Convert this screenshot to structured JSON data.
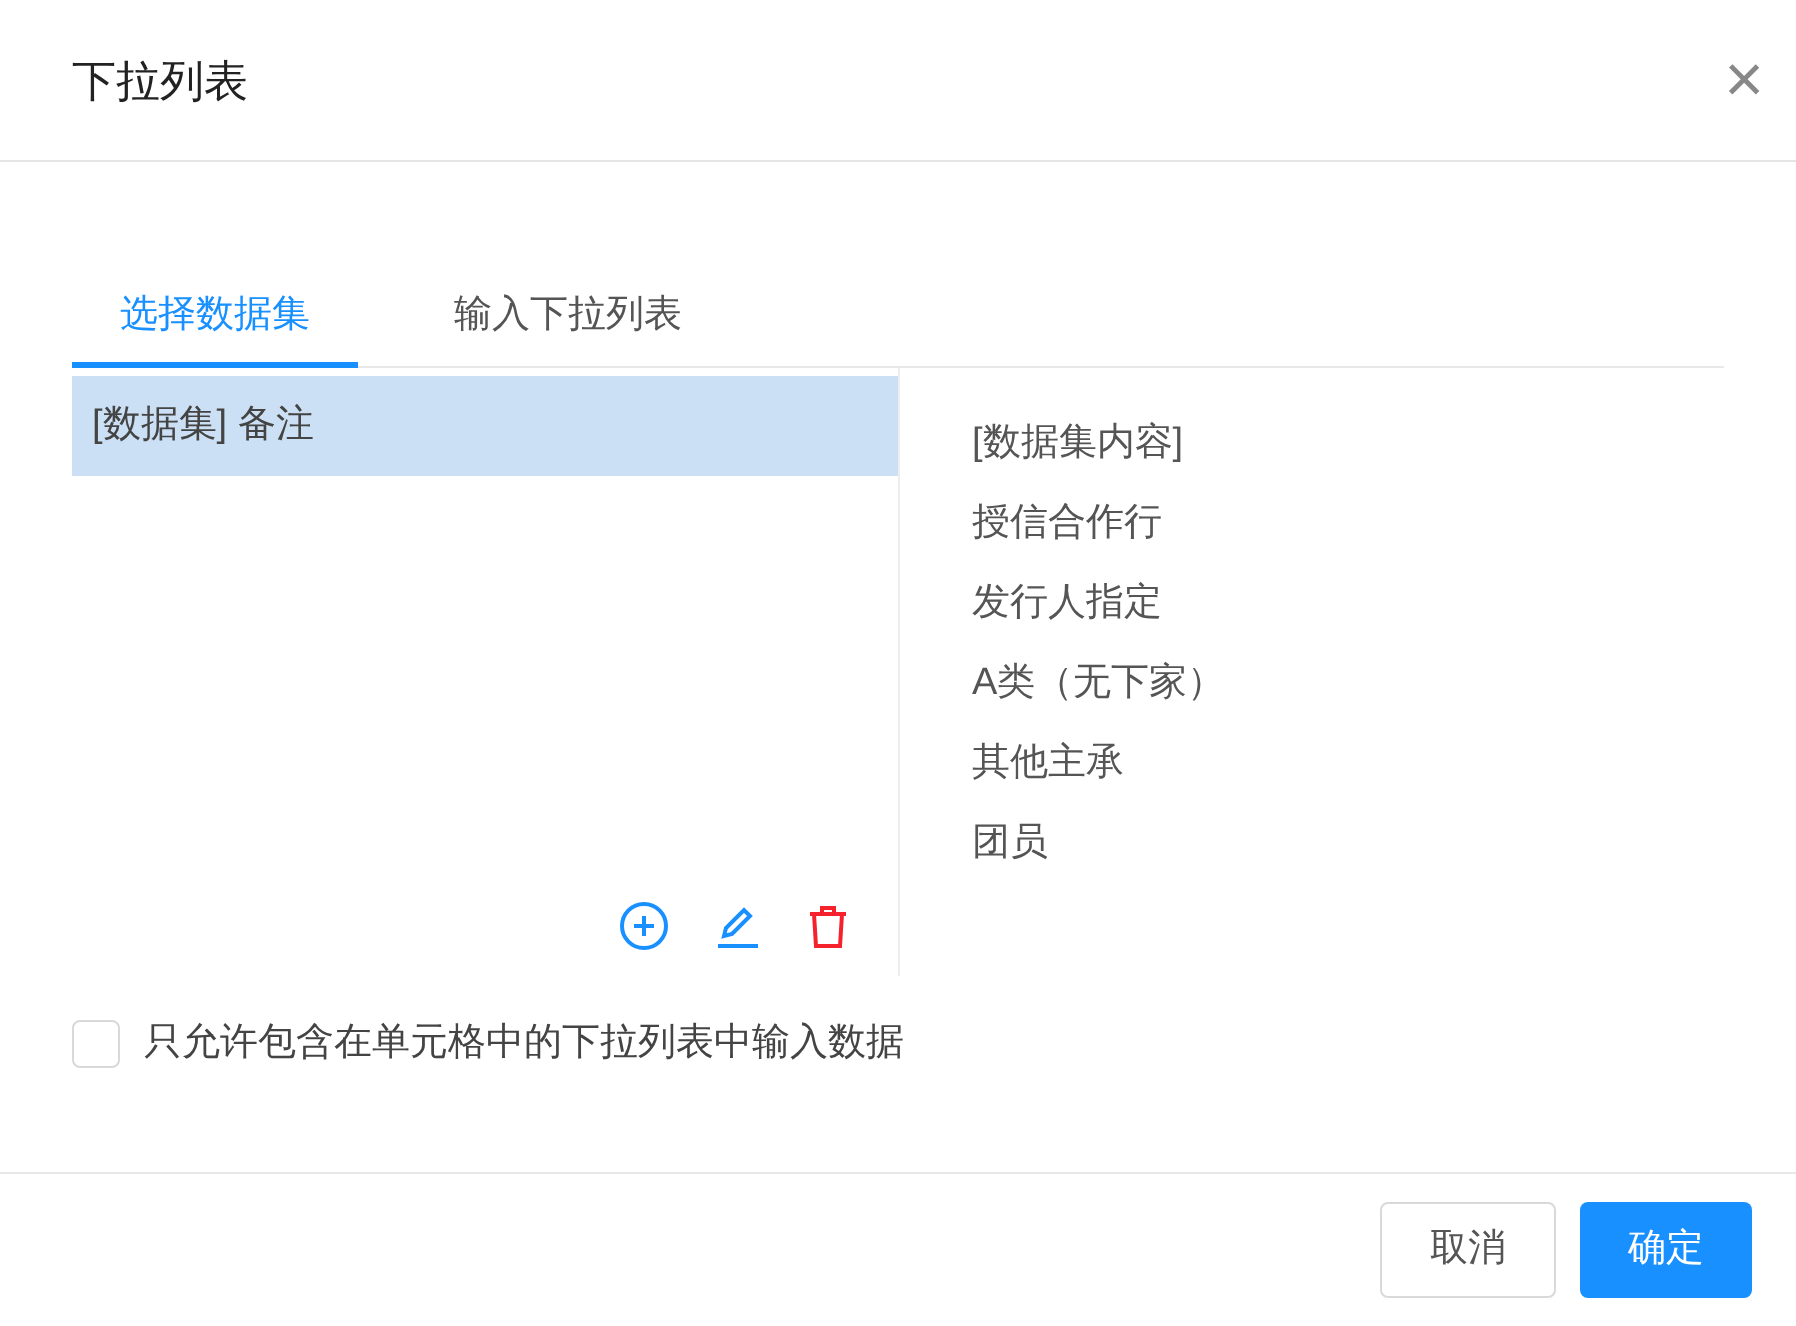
{
  "dialog": {
    "title": "下拉列表",
    "close": "×"
  },
  "tabs": [
    {
      "label": "选择数据集",
      "selected": true
    },
    {
      "label": "输入下拉列表",
      "selected": false
    }
  ],
  "datasets": [
    {
      "label": "[数据集] 备注",
      "selected": true
    }
  ],
  "content": {
    "heading": "[数据集内容]",
    "items": [
      "授信合作行",
      "发行人指定",
      "A类（无下家）",
      "其他主承",
      "团员"
    ]
  },
  "restrict": {
    "label": "只允许包含在单元格中的下拉列表中输入数据",
    "checked": false
  },
  "buttons": [
    {
      "label": "取消",
      "kind": "default"
    },
    {
      "label": "确定",
      "kind": "primary"
    }
  ]
}
